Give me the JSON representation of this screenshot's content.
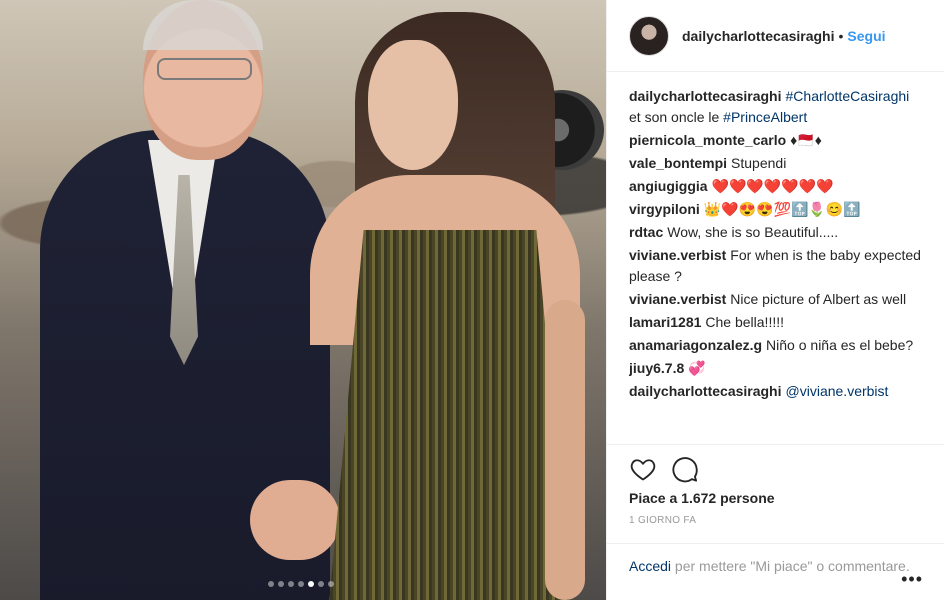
{
  "post": {
    "carousel_total": 7,
    "carousel_active": 5
  },
  "header": {
    "username": "dailycharlottecasiraghi",
    "separator": "•",
    "follow_label": "Segui"
  },
  "caption": {
    "username": "dailycharlottecasiraghi",
    "hashtag1": "#CharlotteCasiraghi",
    "text": " et son oncle le ",
    "hashtag2": "#PrinceAlbert"
  },
  "comments": [
    {
      "username": "piernicola_monte_carlo",
      "text": "♦🇲🇨♦"
    },
    {
      "username": "vale_bontempi",
      "text": "Stupendi"
    },
    {
      "username": "angiugiggia",
      "text": "❤️❤️❤️❤️❤️❤️❤️"
    },
    {
      "username": "virgypiloni",
      "text": "👑❤️😍😍💯🔝🌷😊🔝"
    },
    {
      "username": "rdtac",
      "text": "Wow, she is so Beautiful....."
    },
    {
      "username": "viviane.verbist",
      "text": "For when is the baby expected please ?"
    },
    {
      "username": "viviane.verbist",
      "text": "Nice picture of Albert as well"
    },
    {
      "username": "lamari1281",
      "text": "Che bella!!!!!"
    },
    {
      "username": "anamariagonzalez.g",
      "text": "Niño o niña es el bebe?"
    },
    {
      "username": "jiuy6.7.8",
      "text": "💞"
    }
  ],
  "reply": {
    "username": "dailycharlottecasiraghi",
    "mention": "@viviane.verbist"
  },
  "actions": {
    "likes_text": "Piace a 1.672 persone",
    "time_text": "1 giorno fa"
  },
  "add_comment": {
    "login_label": "Accedi",
    "text": " per mettere \"Mi piace\" o commentare."
  },
  "icons": {
    "like": "heart-icon",
    "comment": "comment-bubble-icon",
    "more": "more-options-icon"
  }
}
